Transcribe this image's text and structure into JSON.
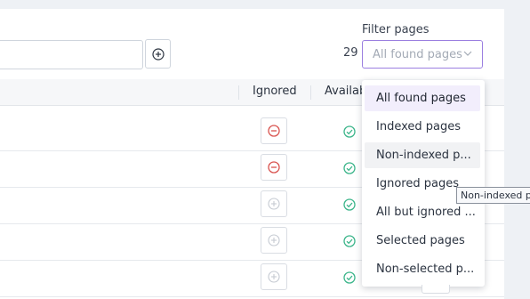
{
  "filter": {
    "label": "Filter pages",
    "count": "29",
    "placeholder": "All found pages",
    "options": [
      "All found pages",
      "Indexed pages",
      "Non-indexed p...",
      "Ignored pages",
      "All but ignored ...",
      "Selected pages",
      "Non-selected p..."
    ],
    "selected_index": 0,
    "hover_index": 2
  },
  "table": {
    "headers": {
      "ignored": "Ignored",
      "available": "Availab"
    },
    "rows": [
      {
        "ignored": true,
        "available": true
      },
      {
        "ignored": true,
        "available": true
      },
      {
        "ignored": false,
        "available": true
      },
      {
        "ignored": false,
        "available": true
      },
      {
        "ignored": false,
        "available": true
      }
    ]
  },
  "tooltip": {
    "text": "Non-indexed pa"
  },
  "colors": {
    "accent": "#9b7fe0",
    "remove_red": "#d9534f",
    "available_green": "#3bb58a"
  },
  "icons": {
    "add": "plus-circle-icon",
    "ignore_remove": "minus-circle-icon",
    "ignore_add": "plus-circle-icon",
    "available": "check-circle-icon",
    "chevron": "chevron-down-icon"
  }
}
